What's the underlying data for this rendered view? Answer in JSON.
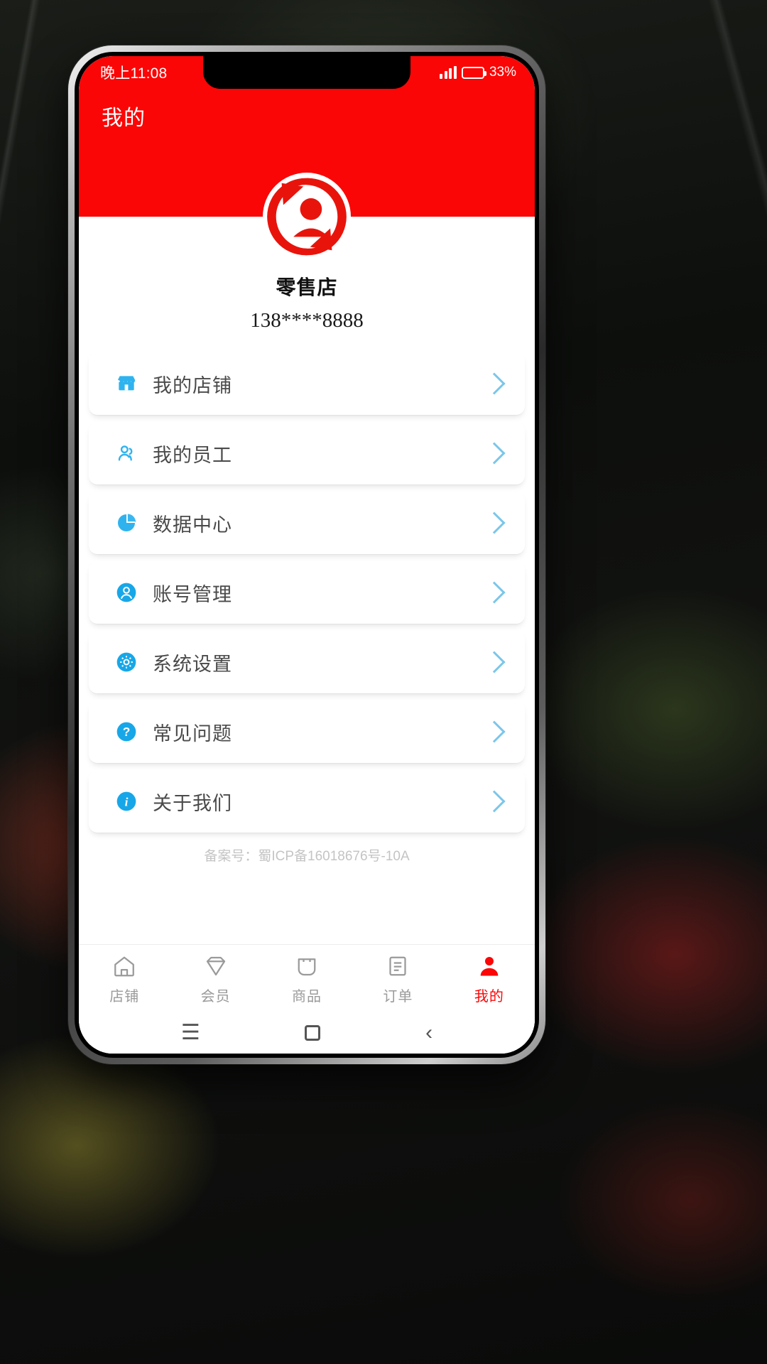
{
  "theme": {
    "brand_red": "#fb0606",
    "accent_blue": "#27a9e8",
    "chevron": "#7cc6ea"
  },
  "status_bar": {
    "time": "晚上11:08",
    "battery_percent": "33%",
    "signal_icon": "signal-bars-icon",
    "battery_icon": "battery-icon"
  },
  "header": {
    "title": "我的"
  },
  "profile": {
    "avatar_icon": "user-refresh-logo-icon",
    "shop_name": "零售店",
    "phone": "138****8888"
  },
  "menu": {
    "items": [
      {
        "label": "我的店铺",
        "icon": "storefront-icon",
        "chevron": "chevron-right-icon"
      },
      {
        "label": "我的员工",
        "icon": "people-icon",
        "chevron": "chevron-right-icon"
      },
      {
        "label": "数据中心",
        "icon": "pie-chart-icon",
        "chevron": "chevron-right-icon"
      },
      {
        "label": "账号管理",
        "icon": "user-circle-icon",
        "chevron": "chevron-right-icon"
      },
      {
        "label": "系统设置",
        "icon": "gear-icon",
        "chevron": "chevron-right-icon"
      },
      {
        "label": "常见问题",
        "icon": "question-circle-icon",
        "chevron": "chevron-right-icon"
      },
      {
        "label": "关于我们",
        "icon": "info-circle-icon",
        "chevron": "chevron-right-icon"
      }
    ]
  },
  "footer": {
    "icp": "备案号：蜀ICP备16018676号-10A"
  },
  "tabbar": {
    "tabs": [
      {
        "label": "店铺",
        "icon": "home-icon",
        "active": false
      },
      {
        "label": "会员",
        "icon": "diamond-icon",
        "active": false
      },
      {
        "label": "商品",
        "icon": "bag-icon",
        "active": false
      },
      {
        "label": "订单",
        "icon": "receipt-icon",
        "active": false
      },
      {
        "label": "我的",
        "icon": "person-filled-icon",
        "active": true
      }
    ]
  },
  "android_nav": {
    "menu": "☰",
    "home_icon": "home-square-icon",
    "back": "‹"
  }
}
